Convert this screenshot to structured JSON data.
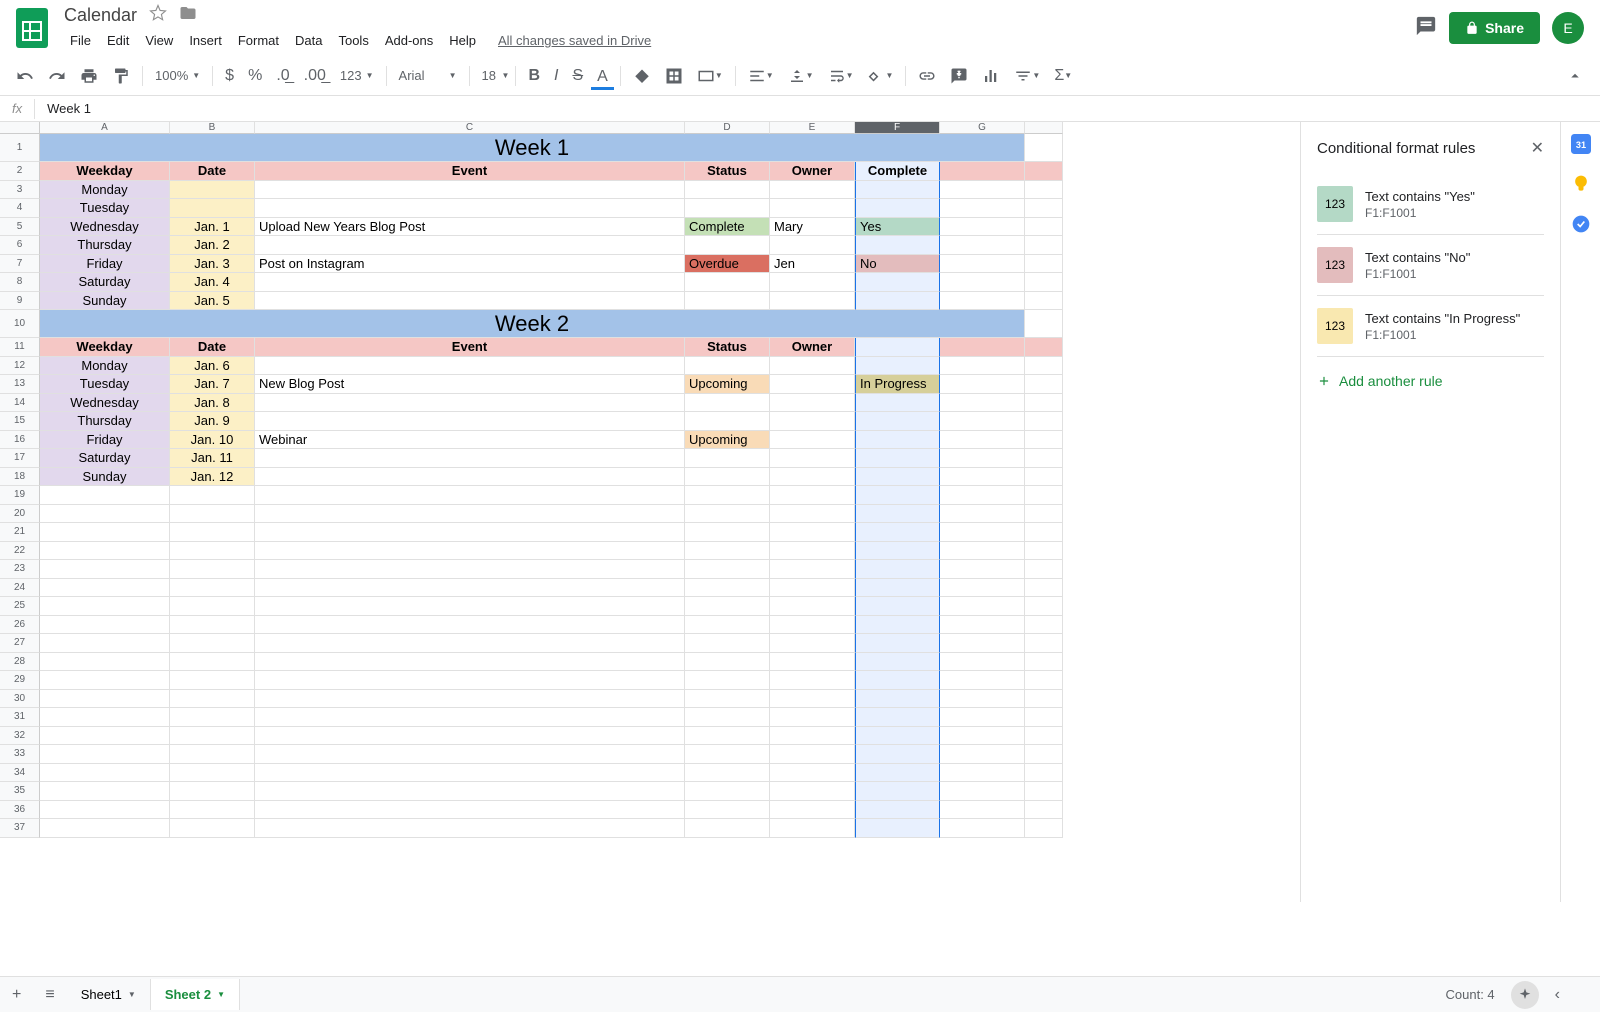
{
  "header": {
    "doc_title": "Calendar",
    "menus": [
      "File",
      "Edit",
      "View",
      "Insert",
      "Format",
      "Data",
      "Tools",
      "Add-ons",
      "Help"
    ],
    "save_status": "All changes saved in Drive",
    "share_label": "Share",
    "avatar_letter": "E"
  },
  "toolbar": {
    "zoom": "100%",
    "num_format": "123",
    "font": "Arial",
    "font_size": "18"
  },
  "formula_bar": {
    "fx_label": "fx",
    "value": "Week 1"
  },
  "columns": [
    "A",
    "B",
    "C",
    "D",
    "E",
    "F",
    "G"
  ],
  "selected_column": "F",
  "rows": [
    {
      "type": "week",
      "text": "Week 1"
    },
    {
      "type": "header",
      "weekday": "Weekday",
      "date": "Date",
      "event": "Event",
      "status": "Status",
      "owner": "Owner",
      "complete": "Complete"
    },
    {
      "type": "data",
      "weekday": "Monday",
      "date": "",
      "event": "",
      "status": "",
      "owner": "",
      "complete": ""
    },
    {
      "type": "data",
      "weekday": "Tuesday",
      "date": "",
      "event": "",
      "status": "",
      "owner": "",
      "complete": ""
    },
    {
      "type": "data",
      "weekday": "Wednesday",
      "date": "Jan. 1",
      "event": "Upload New Years Blog Post",
      "status": "Complete",
      "status_class": "status-complete",
      "owner": "Mary",
      "complete": "Yes",
      "complete_class": "complete-yes"
    },
    {
      "type": "data",
      "weekday": "Thursday",
      "date": "Jan. 2",
      "event": "",
      "status": "",
      "owner": "",
      "complete": ""
    },
    {
      "type": "data",
      "weekday": "Friday",
      "date": "Jan. 3",
      "event": "Post on Instagram",
      "status": "Overdue",
      "status_class": "status-overdue",
      "owner": "Jen",
      "complete": "No",
      "complete_class": "complete-no"
    },
    {
      "type": "data",
      "weekday": "Saturday",
      "date": "Jan. 4",
      "event": "",
      "status": "",
      "owner": "",
      "complete": ""
    },
    {
      "type": "data",
      "weekday": "Sunday",
      "date": "Jan. 5",
      "event": "",
      "status": "",
      "owner": "",
      "complete": ""
    },
    {
      "type": "week",
      "text": "Week 2"
    },
    {
      "type": "header",
      "weekday": "Weekday",
      "date": "Date",
      "event": "Event",
      "status": "Status",
      "owner": "Owner",
      "complete": ""
    },
    {
      "type": "data",
      "weekday": "Monday",
      "date": "Jan. 6",
      "event": "",
      "status": "",
      "owner": "",
      "complete": ""
    },
    {
      "type": "data",
      "weekday": "Tuesday",
      "date": "Jan. 7",
      "event": "New Blog Post",
      "status": "Upcoming",
      "status_class": "status-upcoming",
      "owner": "",
      "complete": "In Progress",
      "complete_class": "complete-prog"
    },
    {
      "type": "data",
      "weekday": "Wednesday",
      "date": "Jan. 8",
      "event": "",
      "status": "",
      "owner": "",
      "complete": ""
    },
    {
      "type": "data",
      "weekday": "Thursday",
      "date": "Jan. 9",
      "event": "",
      "status": "",
      "owner": "",
      "complete": ""
    },
    {
      "type": "data",
      "weekday": "Friday",
      "date": "Jan. 10",
      "event": "Webinar",
      "status": "Upcoming",
      "status_class": "status-upcoming",
      "owner": "",
      "complete": ""
    },
    {
      "type": "data",
      "weekday": "Saturday",
      "date": "Jan. 11",
      "event": "",
      "status": "",
      "owner": "",
      "complete": ""
    },
    {
      "type": "data",
      "weekday": "Sunday",
      "date": "Jan. 12",
      "event": "",
      "status": "",
      "owner": "",
      "complete": ""
    }
  ],
  "empty_rows_start": 19,
  "empty_rows_end": 37,
  "sidebar": {
    "title": "Conditional format rules",
    "swatch_label": "123",
    "rules": [
      {
        "swatch": "swatch-green",
        "text": "Text contains \"Yes\"",
        "range": "F1:F1001"
      },
      {
        "swatch": "swatch-pink",
        "text": "Text contains \"No\"",
        "range": "F1:F1001"
      },
      {
        "swatch": "swatch-yellow",
        "text": "Text contains \"In Progress\"",
        "range": "F1:F1001"
      }
    ],
    "add_label": "Add another rule"
  },
  "bottom": {
    "sheet1": "Sheet1",
    "sheet2": "Sheet 2",
    "count": "Count: 4"
  }
}
